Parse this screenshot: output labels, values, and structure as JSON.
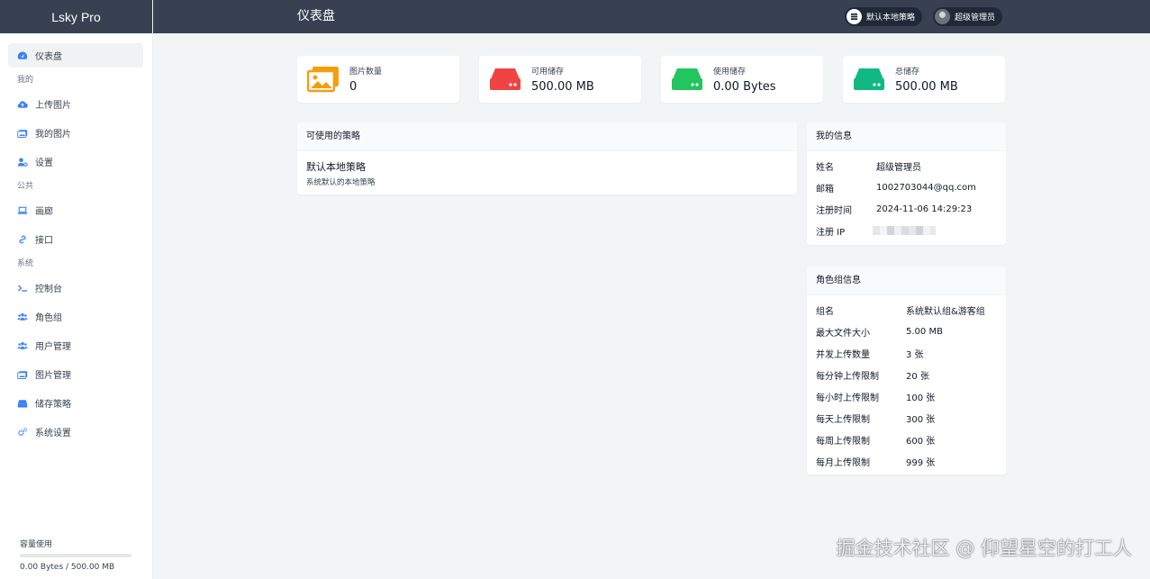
{
  "app": {
    "brand": "Lsky Pro"
  },
  "header": {
    "title": "仪表盘",
    "strategy_label": "默认本地策略",
    "user_label": "超级管理员"
  },
  "sidebar": {
    "items_top": [
      {
        "label": "仪表盘",
        "icon": "dashboard-icon"
      }
    ],
    "group_mine": "我的",
    "items_mine": [
      {
        "label": "上传图片",
        "icon": "cloud-upload-icon"
      },
      {
        "label": "我的图片",
        "icon": "images-icon"
      },
      {
        "label": "设置",
        "icon": "user-cog-icon"
      }
    ],
    "group_public": "公共",
    "items_public": [
      {
        "label": "画廊",
        "icon": "laptop-icon"
      },
      {
        "label": "接口",
        "icon": "link-icon"
      }
    ],
    "group_system": "系统",
    "items_system": [
      {
        "label": "控制台",
        "icon": "terminal-icon"
      },
      {
        "label": "角色组",
        "icon": "users-icon"
      },
      {
        "label": "用户管理",
        "icon": "users-cog-icon"
      },
      {
        "label": "图片管理",
        "icon": "images-icon"
      },
      {
        "label": "储存策略",
        "icon": "hdd-icon"
      },
      {
        "label": "系统设置",
        "icon": "cogs-icon"
      }
    ],
    "quota": {
      "title": "容量使用",
      "text": "0.00 Bytes / 500.00 MB",
      "fraction": 0
    }
  },
  "stats": [
    {
      "label": "图片数量",
      "value": "0",
      "icon": "images-icon",
      "color": "#f59e0b"
    },
    {
      "label": "可用储存",
      "value": "500.00 MB",
      "icon": "hdd-icon",
      "color": "#ef4444"
    },
    {
      "label": "使用储存",
      "value": "0.00 Bytes",
      "icon": "hdd-icon",
      "color": "#22c55e"
    },
    {
      "label": "总储存",
      "value": "500.00 MB",
      "icon": "hdd-icon",
      "color": "#10b981"
    }
  ],
  "strategies": {
    "title": "可使用的策略",
    "items": [
      {
        "name": "默认本地策略",
        "desc": "系统默认的本地策略"
      }
    ]
  },
  "my_info": {
    "title": "我的信息",
    "rows": [
      {
        "k": "姓名",
        "v": "超级管理员"
      },
      {
        "k": "邮箱",
        "v": "1002703044@qq.com"
      },
      {
        "k": "注册时间",
        "v": "2024-11-06 14:29:23"
      },
      {
        "k": "注册 IP",
        "v": ""
      }
    ]
  },
  "role_info": {
    "title": "角色组信息",
    "rows": [
      {
        "k": "组名",
        "v": "系统默认组&游客组"
      },
      {
        "k": "最大文件大小",
        "v": "5.00 MB"
      },
      {
        "k": "并发上传数量",
        "v": "3 张"
      },
      {
        "k": "每分钟上传限制",
        "v": "20 张"
      },
      {
        "k": "每小时上传限制",
        "v": "100 张"
      },
      {
        "k": "每天上传限制",
        "v": "300 张"
      },
      {
        "k": "每周上传限制",
        "v": "600 张"
      },
      {
        "k": "每月上传限制",
        "v": "999 张"
      }
    ]
  },
  "watermark": "掘金技术社区 @ 仰望星空的打工人"
}
